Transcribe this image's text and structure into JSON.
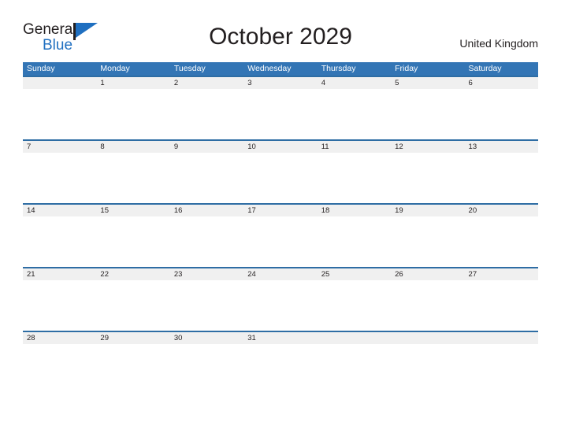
{
  "logo": {
    "word_one": "General",
    "word_two": "Blue",
    "mark_icon": "flag-triangle-icon",
    "dark_color": "#231f20",
    "blue_color": "#1f6fc0"
  },
  "header": {
    "title": "October 2029",
    "country": "United Kingdom"
  },
  "theme": {
    "header_blue": "#3375b5",
    "rule_blue": "#2e6da4",
    "band_gray": "#f0f0f0",
    "text_dark": "#231f20",
    "page_background": "#ffffff"
  },
  "calendar": {
    "month": "October",
    "year": "2029",
    "weekday_headers": [
      "Sunday",
      "Monday",
      "Tuesday",
      "Wednesday",
      "Thursday",
      "Friday",
      "Saturday"
    ],
    "weeks": [
      [
        {
          "day": "",
          "empty": true
        },
        {
          "day": "1",
          "empty": false
        },
        {
          "day": "2",
          "empty": false
        },
        {
          "day": "3",
          "empty": false
        },
        {
          "day": "4",
          "empty": false
        },
        {
          "day": "5",
          "empty": false
        },
        {
          "day": "6",
          "empty": false
        }
      ],
      [
        {
          "day": "7",
          "empty": false
        },
        {
          "day": "8",
          "empty": false
        },
        {
          "day": "9",
          "empty": false
        },
        {
          "day": "10",
          "empty": false
        },
        {
          "day": "11",
          "empty": false
        },
        {
          "day": "12",
          "empty": false
        },
        {
          "day": "13",
          "empty": false
        }
      ],
      [
        {
          "day": "14",
          "empty": false
        },
        {
          "day": "15",
          "empty": false
        },
        {
          "day": "16",
          "empty": false
        },
        {
          "day": "17",
          "empty": false
        },
        {
          "day": "18",
          "empty": false
        },
        {
          "day": "19",
          "empty": false
        },
        {
          "day": "20",
          "empty": false
        }
      ],
      [
        {
          "day": "21",
          "empty": false
        },
        {
          "day": "22",
          "empty": false
        },
        {
          "day": "23",
          "empty": false
        },
        {
          "day": "24",
          "empty": false
        },
        {
          "day": "25",
          "empty": false
        },
        {
          "day": "26",
          "empty": false
        },
        {
          "day": "27",
          "empty": false
        }
      ],
      [
        {
          "day": "28",
          "empty": false
        },
        {
          "day": "29",
          "empty": false
        },
        {
          "day": "30",
          "empty": false
        },
        {
          "day": "31",
          "empty": false
        },
        {
          "day": "",
          "empty": true
        },
        {
          "day": "",
          "empty": true
        },
        {
          "day": "",
          "empty": true
        }
      ]
    ]
  }
}
